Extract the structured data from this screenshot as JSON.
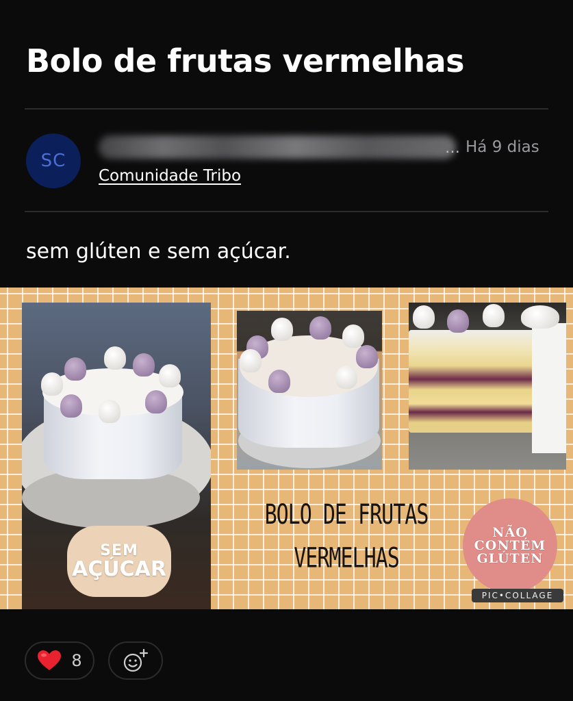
{
  "post": {
    "title": "Bolo de frutas vermelhas",
    "author_initials": "SC",
    "timestamp": "Há 9 dias",
    "community": "Comunidade Tribo",
    "body": "sem glúten e sem açúcar."
  },
  "image": {
    "badge_sem_line1": "SEM",
    "badge_sem_line2": "AÇÚCAR",
    "title_line1": "BOLO DE FRUTAS",
    "title_line2": "VERMELHAS",
    "gluten_line1": "NÃO",
    "gluten_line2": "CONTÉM",
    "gluten_line3": "GLÚTEN",
    "watermark": "PIC•COLLAGE"
  },
  "reactions": {
    "heart_icon": "heart-icon",
    "like_count": "8",
    "add_reaction_icon": "add-emoji-icon"
  },
  "colors": {
    "background": "#0b0b0c",
    "avatar": "#0b1f5a",
    "collage_bg": "#e7b777",
    "heart": "#e8232f"
  }
}
